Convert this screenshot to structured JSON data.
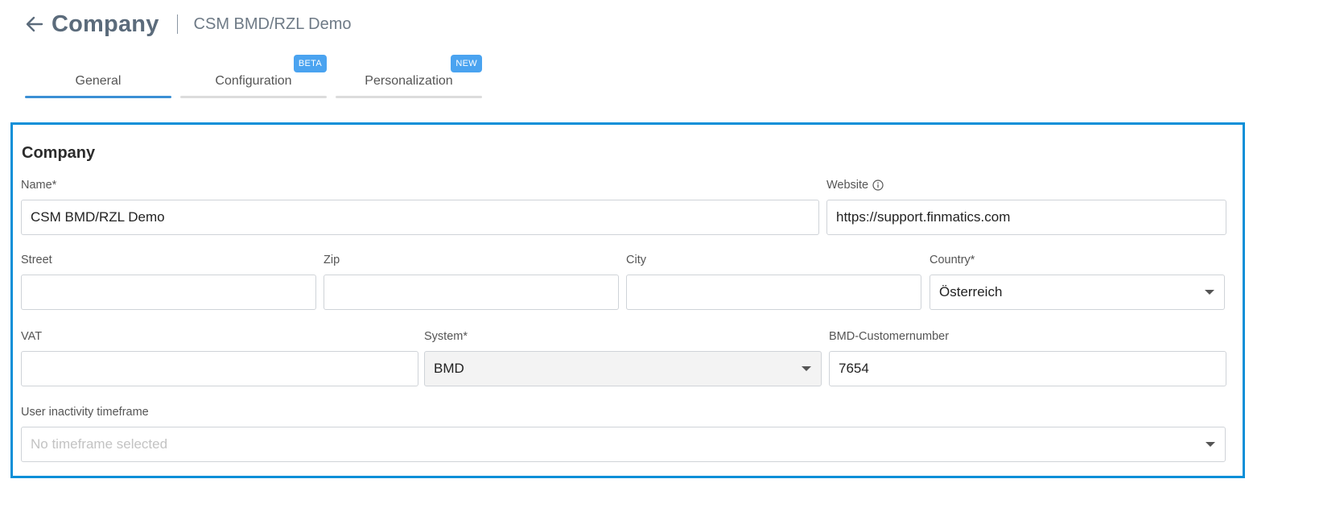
{
  "header": {
    "title": "Company",
    "subtitle": "CSM BMD/RZL Demo"
  },
  "tabs": [
    {
      "label": "General",
      "badge": ""
    },
    {
      "label": "Configuration",
      "badge": "BETA"
    },
    {
      "label": "Personalization",
      "badge": "NEW"
    }
  ],
  "card": {
    "title": "Company",
    "fields": {
      "name": {
        "label": "Name*",
        "value": "CSM BMD/RZL Demo"
      },
      "website": {
        "label": "Website",
        "value": "https://support.finmatics.com"
      },
      "street": {
        "label": "Street",
        "value": ""
      },
      "zip": {
        "label": "Zip",
        "value": ""
      },
      "city": {
        "label": "City",
        "value": ""
      },
      "country": {
        "label": "Country*",
        "value": "Österreich"
      },
      "vat": {
        "label": "VAT",
        "value": ""
      },
      "system": {
        "label": "System*",
        "value": "BMD"
      },
      "customernumber": {
        "label": "BMD-Customernumber",
        "value": "7654"
      },
      "inactivity": {
        "label": "User inactivity timeframe",
        "placeholder": "No timeframe selected"
      }
    }
  },
  "colors": {
    "accent": "#3b8fd4",
    "card_border": "#0a8fd8",
    "badge": "#4aa3f0"
  }
}
